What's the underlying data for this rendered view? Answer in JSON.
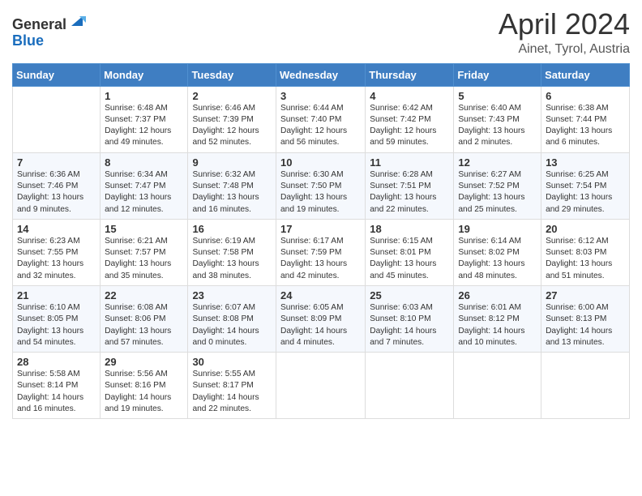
{
  "header": {
    "logo_line1": "General",
    "logo_line2": "Blue",
    "title": "April 2024",
    "location": "Ainet, Tyrol, Austria"
  },
  "weekdays": [
    "Sunday",
    "Monday",
    "Tuesday",
    "Wednesday",
    "Thursday",
    "Friday",
    "Saturday"
  ],
  "weeks": [
    [
      {
        "day": "",
        "info": ""
      },
      {
        "day": "1",
        "info": "Sunrise: 6:48 AM\nSunset: 7:37 PM\nDaylight: 12 hours\nand 49 minutes."
      },
      {
        "day": "2",
        "info": "Sunrise: 6:46 AM\nSunset: 7:39 PM\nDaylight: 12 hours\nand 52 minutes."
      },
      {
        "day": "3",
        "info": "Sunrise: 6:44 AM\nSunset: 7:40 PM\nDaylight: 12 hours\nand 56 minutes."
      },
      {
        "day": "4",
        "info": "Sunrise: 6:42 AM\nSunset: 7:42 PM\nDaylight: 12 hours\nand 59 minutes."
      },
      {
        "day": "5",
        "info": "Sunrise: 6:40 AM\nSunset: 7:43 PM\nDaylight: 13 hours\nand 2 minutes."
      },
      {
        "day": "6",
        "info": "Sunrise: 6:38 AM\nSunset: 7:44 PM\nDaylight: 13 hours\nand 6 minutes."
      }
    ],
    [
      {
        "day": "7",
        "info": "Sunrise: 6:36 AM\nSunset: 7:46 PM\nDaylight: 13 hours\nand 9 minutes."
      },
      {
        "day": "8",
        "info": "Sunrise: 6:34 AM\nSunset: 7:47 PM\nDaylight: 13 hours\nand 12 minutes."
      },
      {
        "day": "9",
        "info": "Sunrise: 6:32 AM\nSunset: 7:48 PM\nDaylight: 13 hours\nand 16 minutes."
      },
      {
        "day": "10",
        "info": "Sunrise: 6:30 AM\nSunset: 7:50 PM\nDaylight: 13 hours\nand 19 minutes."
      },
      {
        "day": "11",
        "info": "Sunrise: 6:28 AM\nSunset: 7:51 PM\nDaylight: 13 hours\nand 22 minutes."
      },
      {
        "day": "12",
        "info": "Sunrise: 6:27 AM\nSunset: 7:52 PM\nDaylight: 13 hours\nand 25 minutes."
      },
      {
        "day": "13",
        "info": "Sunrise: 6:25 AM\nSunset: 7:54 PM\nDaylight: 13 hours\nand 29 minutes."
      }
    ],
    [
      {
        "day": "14",
        "info": "Sunrise: 6:23 AM\nSunset: 7:55 PM\nDaylight: 13 hours\nand 32 minutes."
      },
      {
        "day": "15",
        "info": "Sunrise: 6:21 AM\nSunset: 7:57 PM\nDaylight: 13 hours\nand 35 minutes."
      },
      {
        "day": "16",
        "info": "Sunrise: 6:19 AM\nSunset: 7:58 PM\nDaylight: 13 hours\nand 38 minutes."
      },
      {
        "day": "17",
        "info": "Sunrise: 6:17 AM\nSunset: 7:59 PM\nDaylight: 13 hours\nand 42 minutes."
      },
      {
        "day": "18",
        "info": "Sunrise: 6:15 AM\nSunset: 8:01 PM\nDaylight: 13 hours\nand 45 minutes."
      },
      {
        "day": "19",
        "info": "Sunrise: 6:14 AM\nSunset: 8:02 PM\nDaylight: 13 hours\nand 48 minutes."
      },
      {
        "day": "20",
        "info": "Sunrise: 6:12 AM\nSunset: 8:03 PM\nDaylight: 13 hours\nand 51 minutes."
      }
    ],
    [
      {
        "day": "21",
        "info": "Sunrise: 6:10 AM\nSunset: 8:05 PM\nDaylight: 13 hours\nand 54 minutes."
      },
      {
        "day": "22",
        "info": "Sunrise: 6:08 AM\nSunset: 8:06 PM\nDaylight: 13 hours\nand 57 minutes."
      },
      {
        "day": "23",
        "info": "Sunrise: 6:07 AM\nSunset: 8:08 PM\nDaylight: 14 hours\nand 0 minutes."
      },
      {
        "day": "24",
        "info": "Sunrise: 6:05 AM\nSunset: 8:09 PM\nDaylight: 14 hours\nand 4 minutes."
      },
      {
        "day": "25",
        "info": "Sunrise: 6:03 AM\nSunset: 8:10 PM\nDaylight: 14 hours\nand 7 minutes."
      },
      {
        "day": "26",
        "info": "Sunrise: 6:01 AM\nSunset: 8:12 PM\nDaylight: 14 hours\nand 10 minutes."
      },
      {
        "day": "27",
        "info": "Sunrise: 6:00 AM\nSunset: 8:13 PM\nDaylight: 14 hours\nand 13 minutes."
      }
    ],
    [
      {
        "day": "28",
        "info": "Sunrise: 5:58 AM\nSunset: 8:14 PM\nDaylight: 14 hours\nand 16 minutes."
      },
      {
        "day": "29",
        "info": "Sunrise: 5:56 AM\nSunset: 8:16 PM\nDaylight: 14 hours\nand 19 minutes."
      },
      {
        "day": "30",
        "info": "Sunrise: 5:55 AM\nSunset: 8:17 PM\nDaylight: 14 hours\nand 22 minutes."
      },
      {
        "day": "",
        "info": ""
      },
      {
        "day": "",
        "info": ""
      },
      {
        "day": "",
        "info": ""
      },
      {
        "day": "",
        "info": ""
      }
    ]
  ]
}
